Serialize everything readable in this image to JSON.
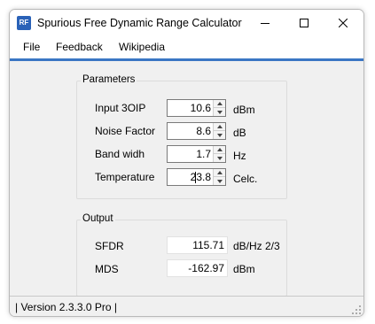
{
  "window": {
    "title": "Spurious Free Dynamic Range Calculator",
    "icon_text": "RF",
    "controls": [
      "minimize",
      "maximize",
      "close"
    ]
  },
  "menu": {
    "file": "File",
    "feedback": "Feedback",
    "wikipedia": "Wikipedia"
  },
  "parameters": {
    "title": "Parameters",
    "input_3oip": {
      "label": "Input 3OIP",
      "value": "10.6",
      "unit": "dBm"
    },
    "noise_factor": {
      "label": "Noise Factor",
      "value": "8.6",
      "unit": "dB"
    },
    "band_width": {
      "label": "Band widh",
      "value": "1.7",
      "unit": "Hz"
    },
    "temperature": {
      "label": "Temperature",
      "value": "23.8",
      "unit": "Celc."
    }
  },
  "output": {
    "title": "Output",
    "sfdr": {
      "label": "SFDR",
      "value": "115.71",
      "unit": "dB/Hz 2/3"
    },
    "mds": {
      "label": "MDS",
      "value": "-162.97",
      "unit": "dBm"
    }
  },
  "status": {
    "text": "| Version 2.3.3.0 Pro |"
  },
  "colors": {
    "accent": "#3a76c4",
    "app_icon": "#2a62b8",
    "background": "#f0f0f0"
  }
}
